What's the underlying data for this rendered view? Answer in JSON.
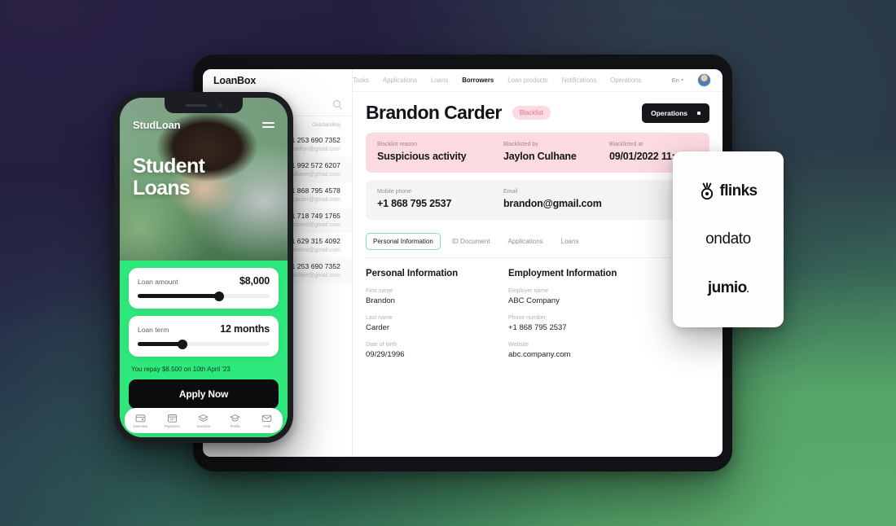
{
  "background": {
    "colors": [
      "#2a2145",
      "#25294a",
      "#2b4550",
      "#3e7a5f",
      "#58a76b"
    ]
  },
  "tablet": {
    "brand": "LoanBox",
    "topnav": [
      {
        "label": "Tasks",
        "active": false
      },
      {
        "label": "Applications",
        "active": false
      },
      {
        "label": "Loans",
        "active": false
      },
      {
        "label": "Borrowers",
        "active": true
      },
      {
        "label": "Loan products",
        "active": false
      },
      {
        "label": "Notifications",
        "active": false
      },
      {
        "label": "Operations",
        "active": false
      }
    ],
    "language": "En",
    "sidebar": {
      "search_icon": "search-icon",
      "column_header": "Outstanding",
      "contacts": [
        {
          "phone": "+1 253 690 7352",
          "email": "cotilfon@gmail.com"
        },
        {
          "phone": "+1 992 572 6207",
          "email": "culhane@gmail.com"
        },
        {
          "phone": "+1 868 795 4578",
          "email": "n.carder@gmail.com"
        },
        {
          "phone": "+1 718 749 1765",
          "email": "asperd@gmail.com"
        },
        {
          "phone": "+1 629 315 4092",
          "email": "siphecnt@gmail.com"
        },
        {
          "phone": "+1 253 690 7352",
          "email": "apnfilpe@gmail.com"
        }
      ]
    },
    "page": {
      "title": "Brandon Carder",
      "status_badge": "Blacklist",
      "operations_button": "Operations",
      "blacklist_panel": [
        {
          "label": "Blacklist reason",
          "value": "Suspicious activity"
        },
        {
          "label": "Blacklisted by",
          "value": "Jaylon Culhane"
        },
        {
          "label": "Blacklisted at",
          "value": "09/01/2022 11:42"
        }
      ],
      "contact_panel": [
        {
          "label": "Mobile phone",
          "value": "+1 868 795 2537"
        },
        {
          "label": "Email",
          "value": "brandon@gmail.com"
        }
      ],
      "tabs": [
        {
          "label": "Personal Information",
          "active": true
        },
        {
          "label": "ID Document",
          "active": false
        },
        {
          "label": "Applications",
          "active": false
        },
        {
          "label": "Loans",
          "active": false
        }
      ],
      "personal_section": {
        "heading": "Personal Information",
        "fields": [
          {
            "label": "First name",
            "value": "Brandon"
          },
          {
            "label": "Last name",
            "value": "Carder"
          },
          {
            "label": "Date of birth",
            "value": "09/29/1996"
          }
        ]
      },
      "employment_section": {
        "heading": "Employment Information",
        "fields": [
          {
            "label": "Employer name",
            "value": "ABC Company"
          },
          {
            "label": "Phone number",
            "value": "+1 868 795 2537"
          },
          {
            "label": "Website",
            "value": "abc.company.com"
          }
        ]
      }
    },
    "accent_green": "#8fd8ab",
    "badge_pink": "#fbdbe0"
  },
  "phone": {
    "brand": "StudLoan",
    "menu_icon": "hamburger-menu-icon",
    "hero_title": "Student\nLoans",
    "hero_title_line1": "Student",
    "hero_title_line2": "Loans",
    "loan_amount": {
      "label": "Loan amount",
      "value": "$8,000",
      "slider_percent": 62
    },
    "loan_term": {
      "label": "Loan term",
      "value": "12 months",
      "slider_percent": 34
    },
    "repay_note": "You repay $8.500 on 10th April '23",
    "apply_button": "Apply Now",
    "accent_green": "#2ee87b",
    "tabbar": [
      {
        "label": "Overview",
        "icon": "wallet-icon"
      },
      {
        "label": "Payments",
        "icon": "calendar-icon"
      },
      {
        "label": "Services",
        "icon": "layers-icon"
      },
      {
        "label": "Profile",
        "icon": "graduation-cap-icon"
      },
      {
        "label": "Help",
        "icon": "envelope-icon"
      }
    ]
  },
  "vendors": {
    "items": [
      {
        "name": "flinks",
        "has_mark": true,
        "weight": "bold"
      },
      {
        "name": "ondato",
        "has_mark": false,
        "weight": "thin"
      },
      {
        "name": "jumio",
        "has_mark": false,
        "weight": "bold",
        "trailing": "."
      }
    ]
  }
}
